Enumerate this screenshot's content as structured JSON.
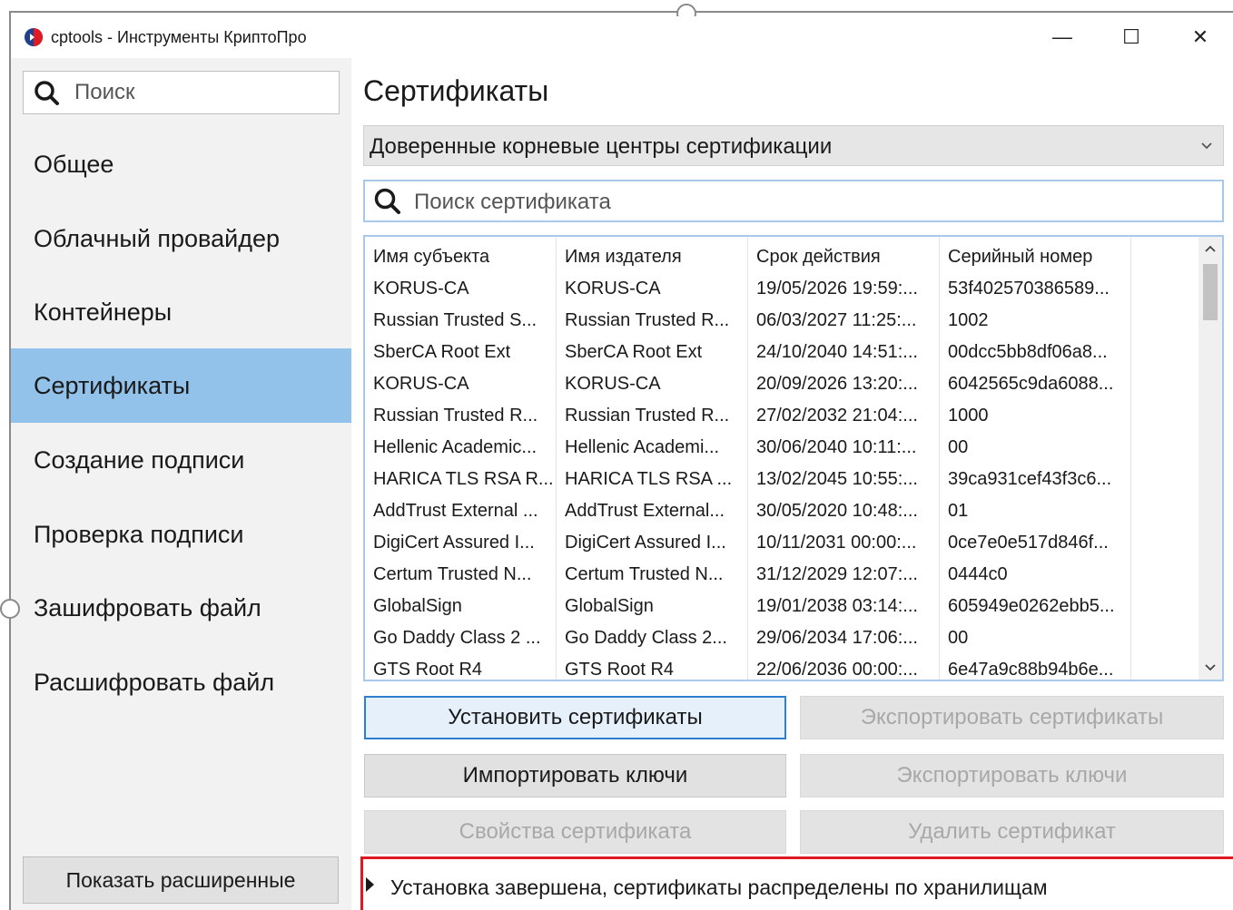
{
  "window": {
    "title": "cptools - Инструменты КриптоПро",
    "minimize_glyph": "—",
    "maximize_glyph": "☐",
    "close_glyph": "✕"
  },
  "sidebar": {
    "search_placeholder": "Поиск",
    "items": [
      {
        "label": "Общее",
        "active": false
      },
      {
        "label": "Облачный провайдер",
        "active": false
      },
      {
        "label": "Контейнеры",
        "active": false
      },
      {
        "label": "Сертификаты",
        "active": true
      },
      {
        "label": "Создание подписи",
        "active": false
      },
      {
        "label": "Проверка подписи",
        "active": false
      },
      {
        "label": "Зашифровать файл",
        "active": false
      },
      {
        "label": "Расшифровать файл",
        "active": false
      }
    ],
    "show_advanced_label": "Показать расширенные"
  },
  "main": {
    "title": "Сертификаты",
    "store_selected": "Доверенные корневые центры сертификации",
    "cert_search_placeholder": "Поиск сертификата",
    "table": {
      "columns": [
        "Имя субъекта",
        "Имя издателя",
        "Срок действия",
        "Серийный номер"
      ],
      "rows": [
        [
          "KORUS-CA",
          "KORUS-CA",
          "19/05/2026 19:59:...",
          "53f402570386589..."
        ],
        [
          "Russian Trusted S...",
          "Russian Trusted R...",
          "06/03/2027 11:25:...",
          "1002"
        ],
        [
          "SberCA Root Ext",
          "SberCA Root Ext",
          "24/10/2040 14:51:...",
          "00dcc5bb8df06a8..."
        ],
        [
          "KORUS-CA",
          "KORUS-CA",
          "20/09/2026 13:20:...",
          "6042565c9da6088..."
        ],
        [
          "Russian Trusted R...",
          "Russian Trusted R...",
          "27/02/2032 21:04:...",
          "1000"
        ],
        [
          "Hellenic Academic...",
          "Hellenic Academi...",
          "30/06/2040 10:11:...",
          "00"
        ],
        [
          "HARICA TLS RSA R...",
          "HARICA TLS RSA ...",
          "13/02/2045 10:55:...",
          "39ca931cef43f3c6..."
        ],
        [
          "AddTrust External ...",
          "AddTrust External...",
          "30/05/2020 10:48:...",
          "01"
        ],
        [
          "DigiCert Assured I...",
          "DigiCert Assured I...",
          "10/11/2031 00:00:...",
          "0ce7e0e517d846f..."
        ],
        [
          "Certum Trusted N...",
          "Certum Trusted N...",
          "31/12/2029 12:07:...",
          "0444c0"
        ],
        [
          "GlobalSign",
          "GlobalSign",
          "19/01/2038 03:14:...",
          "605949e0262ebb5..."
        ],
        [
          "Go Daddy Class 2 ...",
          "Go Daddy Class 2...",
          "29/06/2034 17:06:...",
          "00"
        ],
        [
          "GTS Root R4",
          "GTS Root R4",
          "22/06/2036 00:00:...",
          "6e47a9c88b94b6e..."
        ]
      ]
    },
    "buttons": {
      "install": "Установить сертификаты",
      "export_certs": "Экспортировать сертификаты",
      "import_keys": "Импортировать ключи",
      "export_keys": "Экспортировать ключи",
      "cert_properties": "Свойства сертификата",
      "delete_cert": "Удалить сертификат"
    },
    "status_message": "Установка завершена, сертификаты распределены по хранилищам"
  },
  "colors": {
    "sidebar_bg": "#f2f2f2",
    "active_item": "#92c1e9",
    "focus_border": "#2f7fd1",
    "status_border": "#e01a22"
  }
}
